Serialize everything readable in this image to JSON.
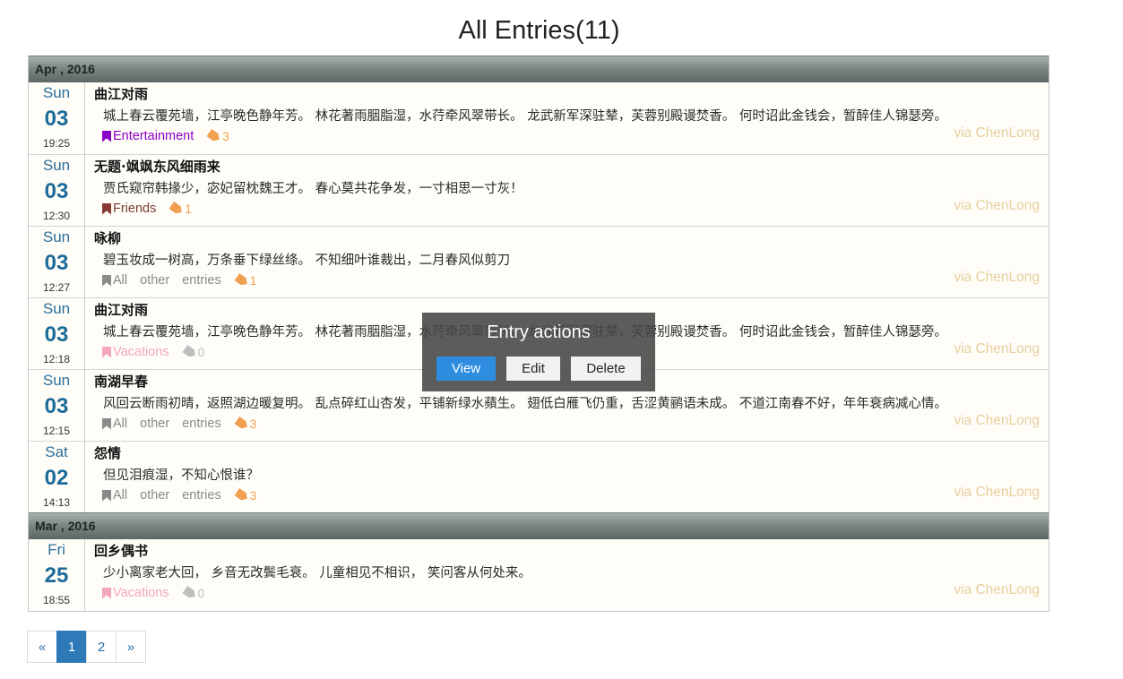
{
  "page": {
    "title": "All Entries(11)"
  },
  "months": [
    {
      "label": "Apr , 2016",
      "entries": [
        {
          "weekday": "Sun",
          "day": "03",
          "time": "19:25",
          "title": "曲江对雨",
          "text": "城上春云覆苑墙，江亭晚色静年芳。 林花著雨胭脂湿，水荇牵风翠带长。 龙武新军深驻辇，芙蓉别殿谩焚香。 何时诏此金钱会，暂醉佳人锦瑟旁。",
          "category": [
            "Entertainment"
          ],
          "category_color": "#8b00c8",
          "tag_count": "3",
          "tag_color": "#f0a050",
          "via": "via ChenLong"
        },
        {
          "weekday": "Sun",
          "day": "03",
          "time": "12:30",
          "title": "无题·飒飒东风细雨来",
          "text": "贾氏窥帘韩掾少，宓妃留枕魏王才。 春心莫共花争发，一寸相思一寸灰！",
          "category": [
            "Friends"
          ],
          "category_color": "#8a3a34",
          "tag_count": "1",
          "tag_color": "#f0a050",
          "via": "via ChenLong"
        },
        {
          "weekday": "Sun",
          "day": "03",
          "time": "12:27",
          "title": "咏柳",
          "text": "碧玉妆成一树高，万条垂下绿丝绦。 不知细叶谁裁出，二月春风似剪刀",
          "category": [
            "All",
            "other",
            "entries"
          ],
          "category_color": "#8a8a8a",
          "tag_count": "1",
          "tag_color": "#f0a050",
          "via": "via ChenLong"
        },
        {
          "weekday": "Sun",
          "day": "03",
          "time": "12:18",
          "title": "曲江对雨",
          "text": "城上春云覆苑墙，江亭晚色静年芳。 林花著雨胭脂湿，水荇牵风翠带长。 龙武新军深驻辇，芙蓉别殿谩焚香。 何时诏此金钱会，暂醉佳人锦瑟旁。",
          "category": [
            "Vacations"
          ],
          "category_color": "#f4a7bb",
          "tag_count": "0",
          "tag_color": "#bdbdbd",
          "via": "via ChenLong"
        },
        {
          "weekday": "Sun",
          "day": "03",
          "time": "12:15",
          "title": "南湖早春",
          "text": "风回云断雨初晴，返照湖边暖复明。 乱点碎红山杏发，平铺新绿水蘋生。 翅低白雁飞仍重，舌涩黄鹂语未成。 不道江南春不好，年年衰病减心情。",
          "category": [
            "All",
            "other",
            "entries"
          ],
          "category_color": "#8a8a8a",
          "tag_count": "3",
          "tag_color": "#f0a050",
          "via": "via ChenLong"
        },
        {
          "weekday": "Sat",
          "day": "02",
          "time": "14:13",
          "title": "怨情",
          "text": "但见泪痕湿，不知心恨谁？",
          "category": [
            "All",
            "other",
            "entries"
          ],
          "category_color": "#8a8a8a",
          "tag_count": "3",
          "tag_color": "#f0a050",
          "via": "via ChenLong"
        }
      ]
    },
    {
      "label": "Mar , 2016",
      "entries": [
        {
          "weekday": "Fri",
          "day": "25",
          "time": "18:55",
          "title": "回乡偶书",
          "text": "少小离家老大回， 乡音无改鬓毛衰。 儿童相见不相识， 笑问客从何处来。",
          "category": [
            "Vacations"
          ],
          "category_color": "#f4a7bb",
          "tag_count": "0",
          "tag_color": "#bdbdbd",
          "via": "via ChenLong"
        }
      ]
    }
  ],
  "pagination": {
    "prev": "«",
    "pages": [
      "1",
      "2"
    ],
    "active": "1",
    "next": "»"
  },
  "overlay": {
    "title": "Entry actions",
    "view_label": "View",
    "edit_label": "Edit",
    "delete_label": "Delete"
  }
}
